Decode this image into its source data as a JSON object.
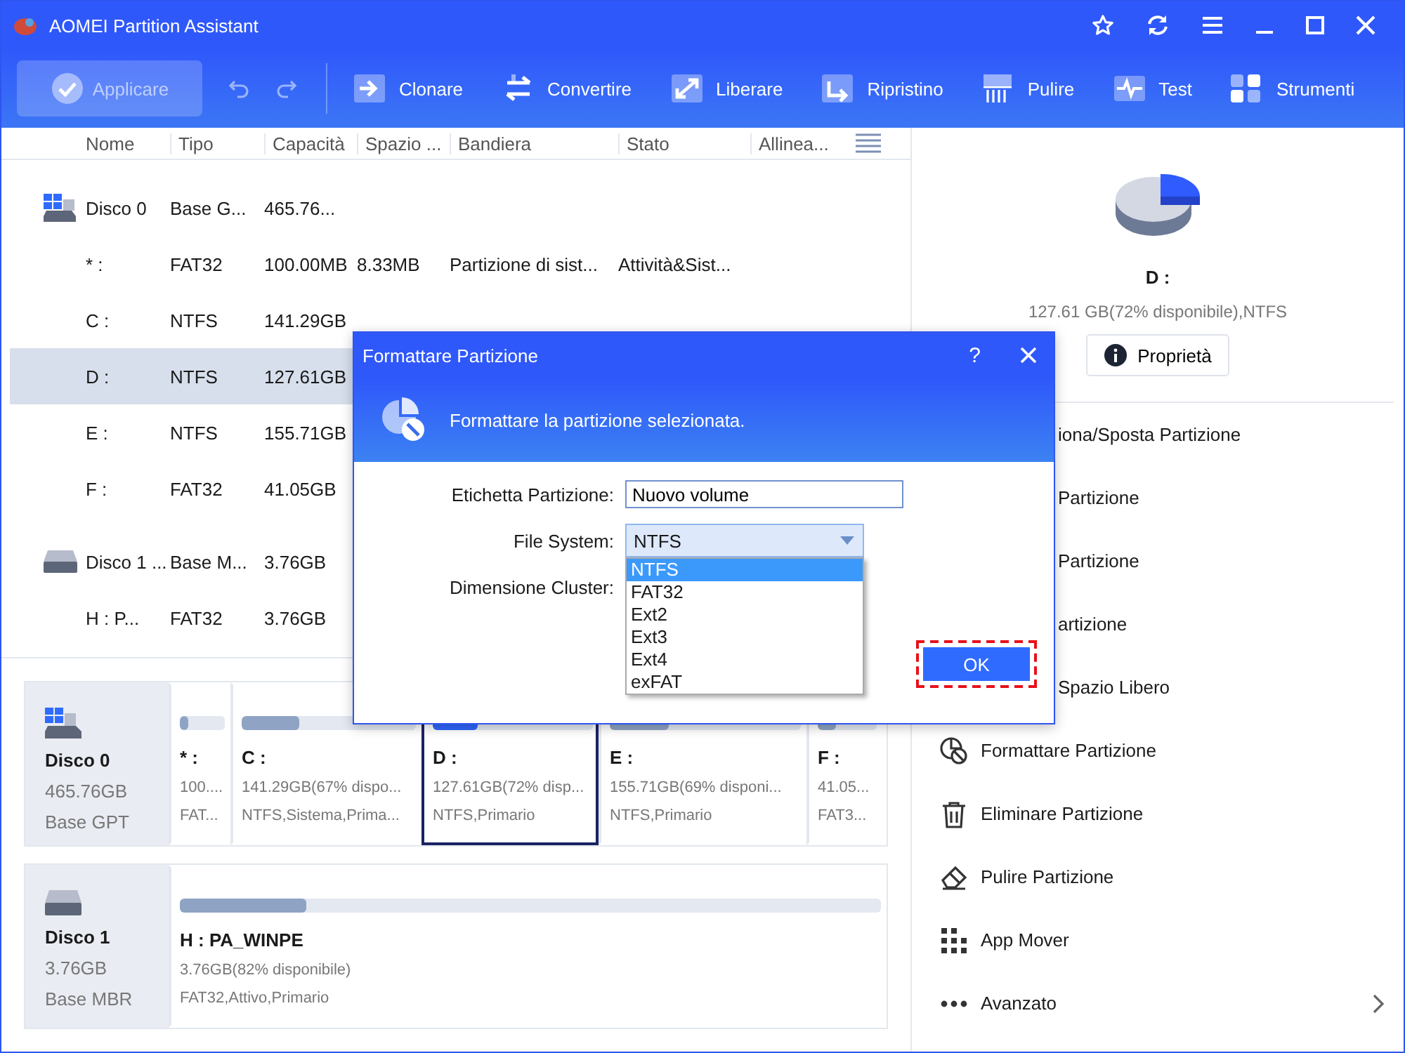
{
  "window": {
    "title": "AOMEI Partition Assistant"
  },
  "toolbar": {
    "apply": {
      "label": "Applicare",
      "disabled": true
    },
    "tools": [
      {
        "label": "Clonare",
        "kind": "clone"
      },
      {
        "label": "Convertire",
        "kind": "convert"
      },
      {
        "label": "Liberare",
        "kind": "free"
      },
      {
        "label": "Ripristino",
        "kind": "restore"
      },
      {
        "label": "Pulire",
        "kind": "wipe"
      },
      {
        "label": "Test",
        "kind": "test"
      },
      {
        "label": "Strumenti",
        "kind": "tools"
      }
    ]
  },
  "table": {
    "columns": [
      "Nome",
      "Tipo",
      "Capacità",
      "Spazio ...",
      "Bandiera",
      "Stato",
      "Allinea..."
    ],
    "rows": [
      {
        "kind": "system-disk",
        "selected": false,
        "cells": [
          "Disco 0",
          "Base G...",
          "465.76..."
        ]
      },
      {
        "kind": "partition",
        "selected": false,
        "cells": [
          "* :",
          "FAT32",
          "100.00MB",
          "8.33MB",
          "Partizione di sist...",
          "Attività&Sist..."
        ]
      },
      {
        "kind": "partition",
        "selected": false,
        "cells": [
          "C :",
          "NTFS",
          "141.29GB"
        ]
      },
      {
        "kind": "partition",
        "selected": true,
        "cells": [
          "D :",
          "NTFS",
          "127.61GB"
        ]
      },
      {
        "kind": "partition",
        "selected": false,
        "cells": [
          "E :",
          "NTFS",
          "155.71GB"
        ]
      },
      {
        "kind": "partition",
        "selected": false,
        "cells": [
          "F :",
          "FAT32",
          "41.05GB"
        ]
      },
      {
        "kind": "disk",
        "selected": false,
        "cells": [
          "Disco 1 ...",
          "Base M...",
          "3.76GB"
        ]
      },
      {
        "kind": "partition",
        "selected": false,
        "cells": [
          "H : P...",
          "FAT32",
          "3.76GB"
        ]
      }
    ]
  },
  "disk_map": [
    {
      "kind": "system-disk",
      "name": "Disco 0",
      "size": "465.76GB",
      "type": "Base GPT",
      "partitions": [
        {
          "label": "* :",
          "info": "100....",
          "flags": "FAT...",
          "level": 0.2,
          "selected": false
        },
        {
          "label": "C :",
          "info": "141.29GB(67% dispo...",
          "flags": "NTFS,Sistema,Prima...",
          "level": 0.33,
          "selected": false
        },
        {
          "label": "D :",
          "info": "127.61GB(72% disp...",
          "flags": "NTFS,Primario",
          "level": 0.28,
          "selected": true
        },
        {
          "label": "E :",
          "info": "155.71GB(69% disponi...",
          "flags": "NTFS,Primario",
          "level": 0.31,
          "selected": false
        },
        {
          "label": "F :",
          "info": "41.05...",
          "flags": "FAT3...",
          "level": 0.3,
          "selected": false
        }
      ]
    },
    {
      "kind": "disk",
      "name": "Disco 1",
      "size": "3.76GB",
      "type": "Base MBR",
      "partitions": [
        {
          "label": "H : PA_WINPE",
          "info": "3.76GB(82% disponibile)",
          "flags": "FAT32,Attivo,Primario",
          "level": 0.18,
          "selected": false
        }
      ]
    }
  ],
  "details": {
    "drive": "D :",
    "summary": "127.61 GB(72% disponibile),NTFS",
    "properties_button": "Proprietà",
    "operations": [
      {
        "label": "iona/Sposta Partizione",
        "kind": "covered"
      },
      {
        "label": "Partizione",
        "kind": "covered"
      },
      {
        "label": "Partizione",
        "kind": "covered"
      },
      {
        "label": "artizione",
        "kind": "covered"
      },
      {
        "label": "Spazio Libero",
        "kind": "covered"
      },
      {
        "label": "Formattare Partizione",
        "kind": "format"
      },
      {
        "label": "Eliminare Partizione",
        "kind": "delete"
      },
      {
        "label": "Pulire Partizione",
        "kind": "wipe"
      },
      {
        "label": "App Mover",
        "kind": "app-mover"
      },
      {
        "label": "Avanzato",
        "kind": "advanced"
      }
    ]
  },
  "dialog": {
    "title": "Formattare Partizione",
    "help": "?",
    "header": "Formattare la partizione selezionata.",
    "fields": [
      {
        "kind": "text",
        "label": "Etichetta Partizione:",
        "value": "Nuovo volume"
      },
      {
        "kind": "select",
        "label": "File System:",
        "value": "NTFS",
        "expanded": true,
        "options": [
          {
            "label": "NTFS",
            "selected": true
          },
          {
            "label": "FAT32",
            "selected": false
          },
          {
            "label": "Ext2",
            "selected": false
          },
          {
            "label": "Ext3",
            "selected": false
          },
          {
            "label": "Ext4",
            "selected": false
          },
          {
            "label": "exFAT",
            "selected": false
          }
        ]
      },
      {
        "kind": "label",
        "label": "Dimensione Cluster:"
      }
    ],
    "ok_button": {
      "label": "OK",
      "highlighted": true
    }
  }
}
